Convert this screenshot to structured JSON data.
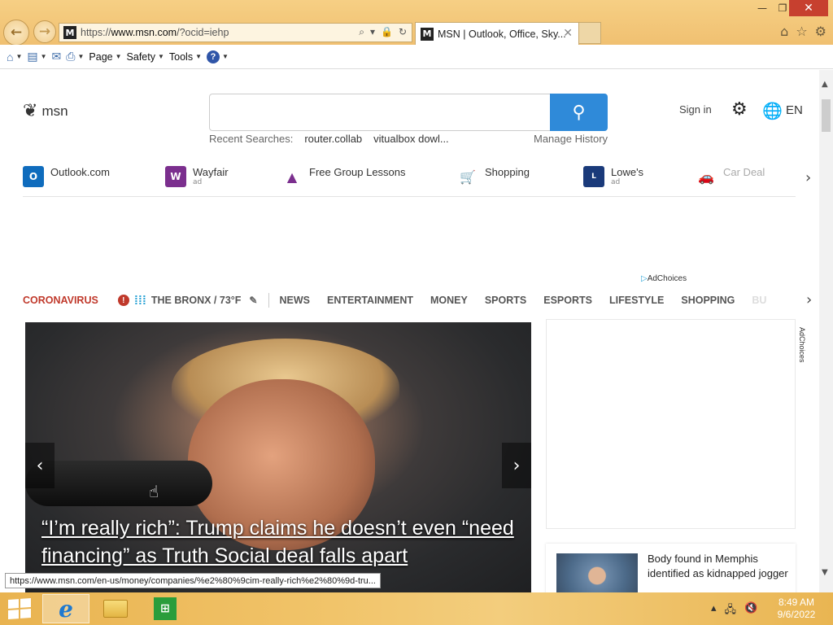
{
  "browser": {
    "url_scheme": "https://",
    "url_host": "www.msn.com",
    "url_path": "/?ocid=iehp",
    "tab_title": "MSN | Outlook, Office, Sky...",
    "tab_favicon_letter": "M",
    "min_glyph": "—",
    "max_glyph": "❐",
    "close_glyph": "✕"
  },
  "commandbar": {
    "page_label": "Page",
    "safety_label": "Safety",
    "tools_label": "Tools",
    "help_glyph": "?"
  },
  "header": {
    "logo_text": "msn",
    "search_placeholder": "",
    "recent_label": "Recent Searches:",
    "recent_items": [
      "router.collab",
      "vitualbox dowl..."
    ],
    "manage_history": "Manage History",
    "signin": "Sign in",
    "language": "EN"
  },
  "quicklinks": [
    {
      "label": "Outlook.com",
      "ad": "",
      "color": "#0f6cbd",
      "icon_glyph": "O"
    },
    {
      "label": "Wayfair",
      "ad": "ad",
      "color": "#7b2f8e",
      "icon_glyph": "W"
    },
    {
      "label": "Free Group Lessons",
      "ad": "",
      "color": "#7b2f8e",
      "icon_glyph": "▲"
    },
    {
      "label": "Shopping",
      "ad": "",
      "color": "#1e6fd9",
      "icon_glyph": "🛒"
    },
    {
      "label": "Lowe's",
      "ad": "ad",
      "color": "#1a3a7a",
      "icon_glyph": "L"
    },
    {
      "label": "Car Deal",
      "ad": "",
      "color": "#2b7cc7",
      "icon_glyph": "🚗"
    }
  ],
  "adchoices": "AdChoices",
  "categories": {
    "coronavirus": "CORONAVIRUS",
    "weather": "THE BRONX / 73°F",
    "items": [
      "NEWS",
      "ENTERTAINMENT",
      "MONEY",
      "SPORTS",
      "ESPORTS",
      "LIFESTYLE",
      "SHOPPING"
    ],
    "partial": "BU"
  },
  "hero": {
    "headline": "“I’m really rich”: Trump claims he doesn’t even “need financing” as Truth Social deal falls apart"
  },
  "side_news": {
    "title": "Body found in Memphis identified as kidnapped jogger"
  },
  "status_url": "https://www.msn.com/en-us/money/companies/%e2%80%9cim-really-rich%e2%80%9d-tru...",
  "taskbar": {
    "time": "8:49 AM",
    "date": "9/6/2022"
  },
  "colors": {
    "accent": "#2f8ad9",
    "coronavirus": "#c0392b",
    "titlebar": "#f0c071"
  }
}
